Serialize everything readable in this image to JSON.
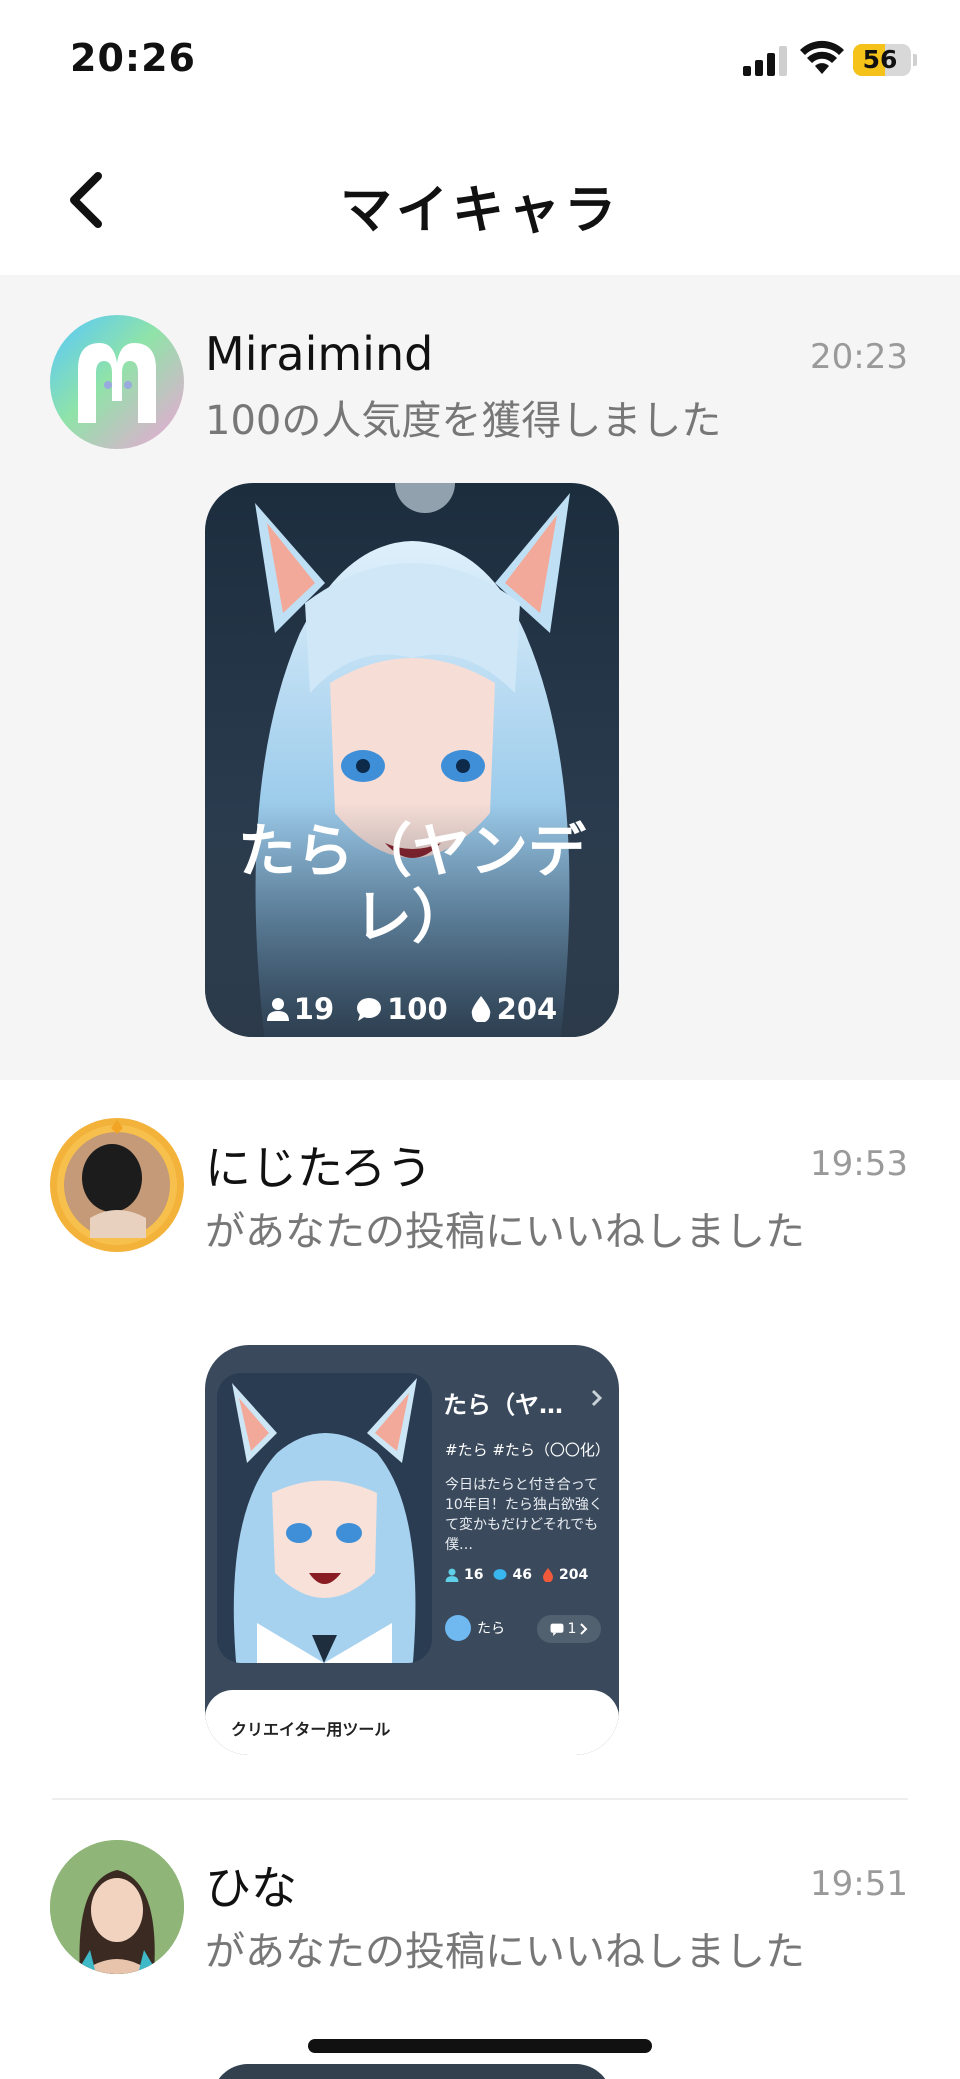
{
  "status_bar": {
    "time": "20:26",
    "battery": 56
  },
  "header": {
    "title": "マイキャラ"
  },
  "notifications": [
    {
      "user": "Miraimind",
      "time": "20:23",
      "message": "100の人気度を獲得しました",
      "card": {
        "name": "たら（ヤンデレ）",
        "stats": {
          "users": "19",
          "chats": "100",
          "likes": "204"
        }
      }
    },
    {
      "user": "にじたろう",
      "time": "19:53",
      "message": "があなたの投稿にいいねしました",
      "post": {
        "title": "たら（ヤ…",
        "tags": "#たら #たら（〇〇化）",
        "description": "今日はたらと付き合って10年目！たら独占欲強くて変かもだけどそれでも僕…",
        "stats": {
          "users": "16",
          "chats": "46",
          "likes": "204"
        },
        "author": "たら",
        "comments": "1",
        "tools_label": "クリエイター用ツール"
      }
    },
    {
      "user": "ひな",
      "time": "19:51",
      "message": "があなたの投稿にいいねしました"
    }
  ],
  "colors": {
    "accent_battery": "#f5c21a",
    "muted_text": "#777777",
    "timestamp": "#9a9a9a"
  }
}
